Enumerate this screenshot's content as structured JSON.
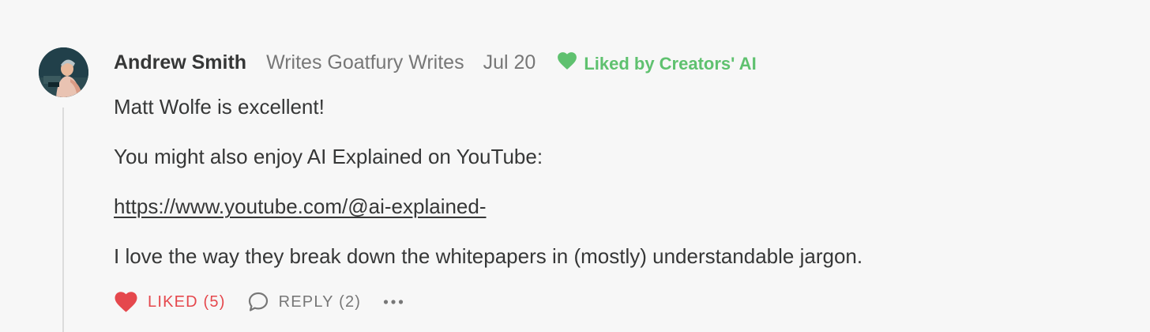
{
  "comment": {
    "author": "Andrew Smith",
    "publication": "Writes Goatfury Writes",
    "date": "Jul 20",
    "liked_by": "Liked by Creators' AI",
    "paragraphs": [
      "Matt Wolfe is excellent!",
      "You might also enjoy AI Explained on YouTube:",
      "I love the way they break down the whitepapers in (mostly) understandable jargon."
    ],
    "link_text": "https://www.youtube.com/@ai-explained-"
  },
  "actions": {
    "like_label": "LIKED (5)",
    "reply_label": "REPLY (2)",
    "more_label": "•••"
  },
  "colors": {
    "background": "#f7f7f7",
    "liked_green": "#5fc16f",
    "liked_red": "#e5484d",
    "muted": "#777777",
    "text": "#363737"
  },
  "icons": {
    "liked_by": "heart-icon",
    "like": "heart-icon",
    "reply": "speech-bubble-icon",
    "more": "ellipsis-icon"
  }
}
